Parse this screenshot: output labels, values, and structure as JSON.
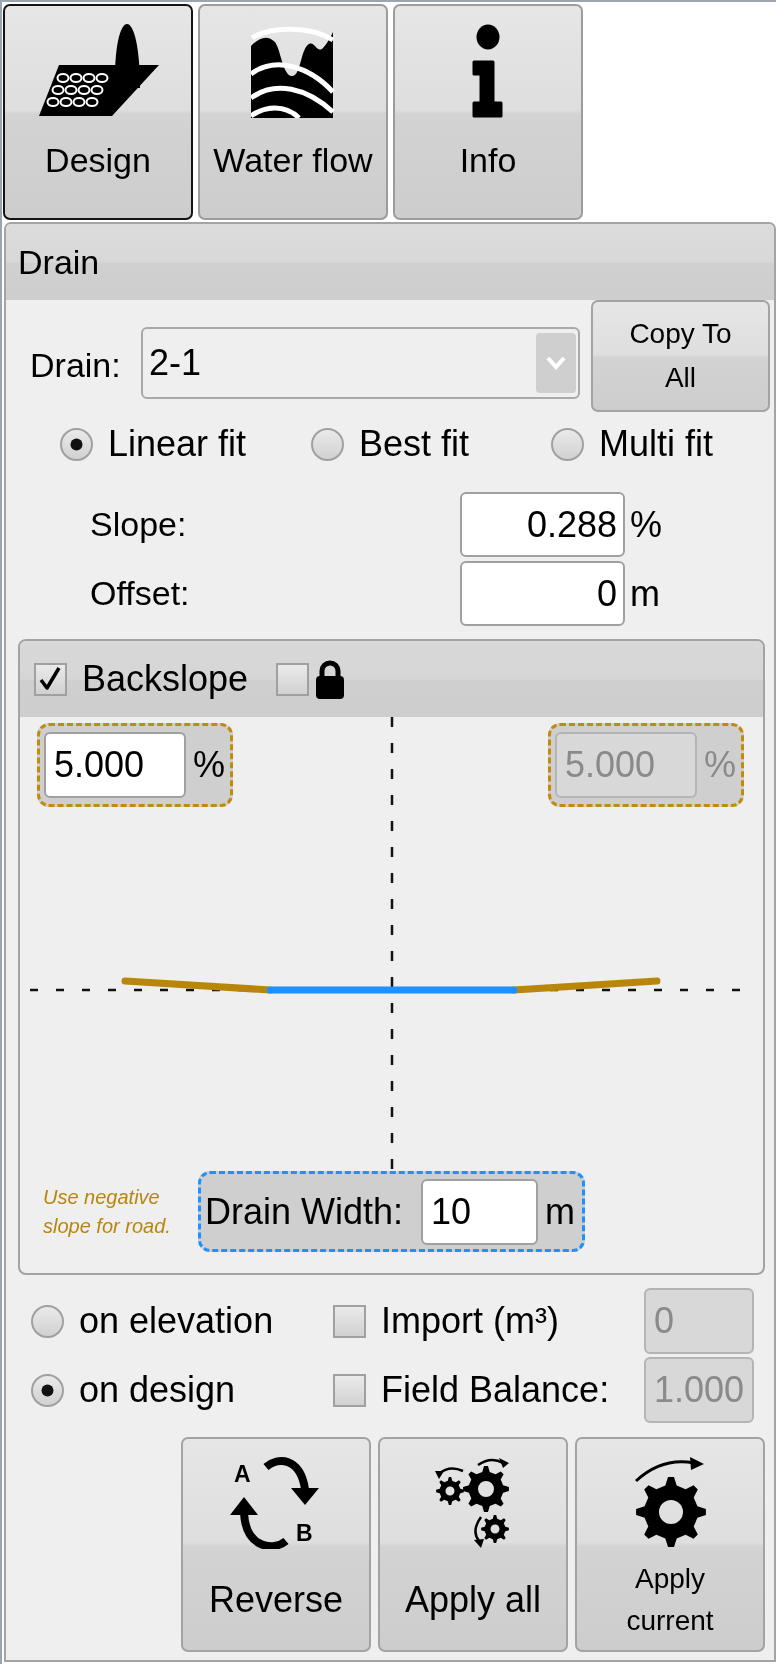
{
  "tabs": [
    {
      "label": "Design",
      "selected": true
    },
    {
      "label": "Water flow",
      "selected": false
    },
    {
      "label": "Info",
      "selected": false
    }
  ],
  "panel": {
    "title": "Drain",
    "drain_select": {
      "label": "Drain:",
      "value": "2-1"
    },
    "copy_button": {
      "label": "Copy To All"
    },
    "fit_modes": [
      {
        "label": "Linear fit",
        "selected": true
      },
      {
        "label": "Best fit",
        "selected": false
      },
      {
        "label": "Multi fit",
        "selected": false
      }
    ],
    "fields": [
      {
        "label": "Slope:",
        "value": "0.288",
        "unit": "%"
      },
      {
        "label": "Offset:",
        "value": "0",
        "unit": "m"
      }
    ],
    "backslope": {
      "label": "Backslope",
      "checked": true,
      "lock": {
        "checked": false
      },
      "left": {
        "value": "5.000",
        "unit": "%",
        "disabled": false
      },
      "right": {
        "value": "5.000",
        "unit": "%",
        "disabled": true
      },
      "note": "Use negative slope for road.",
      "drain_width": {
        "label": "Drain Width:",
        "value": "10",
        "unit": "m"
      }
    },
    "base_modes": [
      {
        "label": "on elevation",
        "selected": false
      },
      {
        "label": "on design",
        "selected": true
      }
    ],
    "options": [
      {
        "label": "Import (m³)",
        "checked": false,
        "value": "0",
        "disabled": true
      },
      {
        "label": "Field Balance:",
        "checked": false,
        "value": "1.000",
        "disabled": true
      }
    ],
    "actions": [
      {
        "label": "Reverse",
        "endpoints": [
          "A",
          "B"
        ]
      },
      {
        "label": "Apply all"
      },
      {
        "label": "Apply current"
      }
    ]
  }
}
